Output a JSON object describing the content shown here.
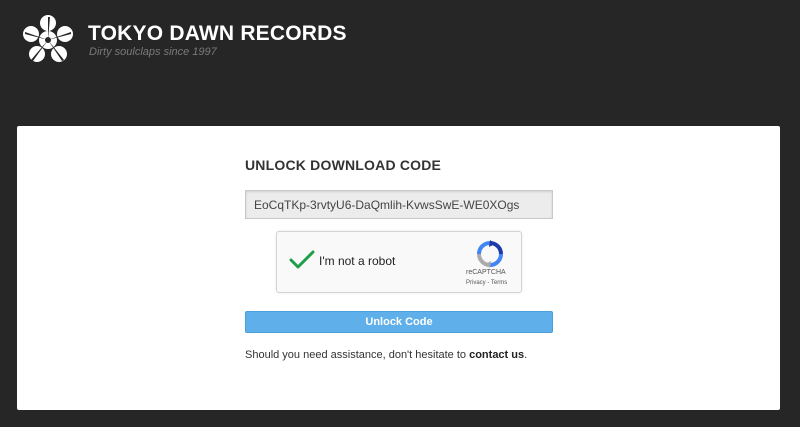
{
  "header": {
    "logo_icon": "flower-blossom-icon",
    "title": "TOKYO DAWN RECORDS",
    "tagline": "Dirty soulclaps since 1997"
  },
  "form": {
    "title": "UNLOCK DOWNLOAD CODE",
    "code_value": "EoCqTKp-3rvtyU6-DaQmlih-KvwsSwE-WE0XOgs",
    "captcha": {
      "check_icon": "checkmark-icon",
      "label": "I'm not a robot",
      "logo_icon": "recaptcha-icon",
      "brand": "reCAPTCHA",
      "privacy": "Privacy",
      "separator": " - ",
      "terms": "Terms"
    },
    "unlock_label": "Unlock Code",
    "assist_text": "Should you need assistance, don't hesitate to ",
    "contact_link": "contact us",
    "assist_end": "."
  },
  "colors": {
    "background": "#262626",
    "panel": "#ffffff",
    "button": "#5fb0ea",
    "check": "#1e9e48"
  }
}
